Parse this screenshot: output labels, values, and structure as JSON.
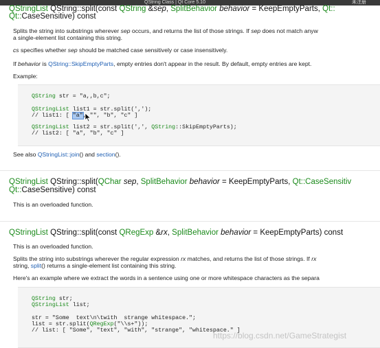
{
  "window": {
    "title": "QString Class | Qt Core 5.10",
    "right_text": "未注册"
  },
  "sec1": {
    "sig_pre": "QStringList",
    "sig_mid": " QString::split(const ",
    "sig_type": "QString",
    "sig_amp": " &",
    "sig_param": "sep",
    "sig_comma": ", ",
    "sig_sb": "SplitBehavior",
    "sig_beh": " behavior",
    "sig_def": " = KeepEmptyParts, ",
    "sig_qt": "Qt::",
    "sig_line2a": "Qt::",
    "sig_line2b": "CaseSensitive) const",
    "desc1": "Splits the string into substrings wherever",
    "desc1_sep": "sep",
    "desc1_b": "occurs, and returns the list of those strings. If",
    "desc1_sep2": "sep",
    "desc1_c": "does not match anyw",
    "desc2": "a single-element list containing this string.",
    "cs_line_cs": "cs",
    "cs_line_a": "specifies whether",
    "cs_line_sep": "sep",
    "cs_line_b": "should be matched case sensitively or case insensitively.",
    "beh_a": "If",
    "beh_b": "behavior",
    "beh_c": "is",
    "beh_link": "QString::SkipEmptyParts",
    "beh_d": ", empty entries don't appear in the result. By default, empty entries are kept.",
    "example_label": "Example:",
    "code": {
      "l1_kw": "QString",
      "l1_rest": " str = \"a,,b,c\";",
      "l2_kw": "QStringList",
      "l2_rest": " list1 = str.split(',');",
      "l3_a": "// list1: [ ",
      "l3_hl": "\"a\"",
      "l3_b": ", \"\", \"b\", \"c\" ]",
      "l4_kw": "QStringList",
      "l4_a": " list2 = str.split(',', ",
      "l4_kw2": "QString",
      "l4_b": "::SkipEmptyParts);",
      "l5": "// list2: [ \"a\", \"b\", \"c\" ]"
    },
    "see_also_a": "See also",
    "see_link1": "QStringList::join",
    "see_mid": "() and",
    "see_link2": "section",
    "see_end": "()."
  },
  "sec2": {
    "sig_pre": "QStringList",
    "sig_mid": " QString::split(",
    "sig_type": "QChar",
    "sig_param": " sep",
    "sig_comma": ", ",
    "sig_sb": "SplitBehavior",
    "sig_beh": " behavior",
    "sig_def": " = KeepEmptyParts, ",
    "sig_qt": "Qt::CaseSensitiv",
    "sig_line2a": "Qt::",
    "sig_line2b": "CaseSensitive) const",
    "desc": "This is an overloaded function."
  },
  "sec3": {
    "sig_pre": "QStringList",
    "sig_mid": " QString::split(const ",
    "sig_type": "QRegExp",
    "sig_amp": " &",
    "sig_param": "rx",
    "sig_comma": ", ",
    "sig_sb": "SplitBehavior",
    "sig_beh": " behavior",
    "sig_def": " = KeepEmptyParts) const",
    "desc": "This is an overloaded function.",
    "p1_a": "Splits the string into substrings wherever the regular expression",
    "p1_rx": "rx",
    "p1_b": "matches, and returns the list of those strings. If",
    "p1_rx2": "rx",
    "p2_a": "string,",
    "p2_link": "split",
    "p2_b": "() returns a single-element list containing this string.",
    "p3": "Here's an example where we extract the words in a sentence using one or more whitespace characters as the separa",
    "code": {
      "l1_kw": "QString",
      "l1_rest": " str;",
      "l2_kw": "QStringList",
      "l2_rest": " list;",
      "l3": "str = \"Some  text\\n\\twith  strange whitespace.\";",
      "l4_a": "list = str.split(",
      "l4_kw": "QRegExp",
      "l4_b": "(\"\\\\s+\"));",
      "l5": "// list: [ \"Some\", \"text\", \"with\", \"strange\", \"whitespace.\" ]"
    }
  },
  "watermark": "https://blog.csdn.net/GameStrategist"
}
